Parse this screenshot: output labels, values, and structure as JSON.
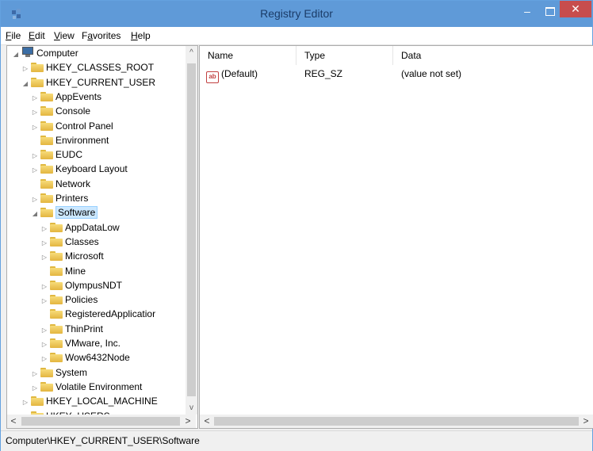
{
  "window": {
    "title": "Registry Editor",
    "minimize_glyph": "–",
    "close_glyph": "✕"
  },
  "menu": {
    "file": {
      "acc": "F",
      "rest": "ile"
    },
    "edit": {
      "acc": "E",
      "rest": "dit"
    },
    "view": {
      "acc": "V",
      "rest": "iew"
    },
    "favorites": {
      "pre": "F",
      "acc": "a",
      "rest": "vorites"
    },
    "help": {
      "acc": "H",
      "rest": "elp"
    }
  },
  "tree": {
    "nodes": [
      {
        "label": "Computer",
        "expander": "◢",
        "icon": "computer-icon"
      },
      {
        "label": "HKEY_CLASSES_ROOT",
        "expander": "▷",
        "icon": "folder-icon"
      },
      {
        "label": "HKEY_CURRENT_USER",
        "expander": "◢",
        "icon": "folder-icon"
      },
      {
        "label": "AppEvents",
        "expander": "▷",
        "icon": "folder-icon"
      },
      {
        "label": "Console",
        "expander": "▷",
        "icon": "folder-icon"
      },
      {
        "label": "Control Panel",
        "expander": "▷",
        "icon": "folder-icon"
      },
      {
        "label": "Environment",
        "expander": "",
        "icon": "folder-icon"
      },
      {
        "label": "EUDC",
        "expander": "▷",
        "icon": "folder-icon"
      },
      {
        "label": "Keyboard Layout",
        "expander": "▷",
        "icon": "folder-icon"
      },
      {
        "label": "Network",
        "expander": "",
        "icon": "folder-icon"
      },
      {
        "label": "Printers",
        "expander": "▷",
        "icon": "folder-icon"
      },
      {
        "label": "Software",
        "expander": "◢",
        "icon": "folder-icon",
        "selected": true
      },
      {
        "label": "AppDataLow",
        "expander": "▷",
        "icon": "folder-icon"
      },
      {
        "label": "Classes",
        "expander": "▷",
        "icon": "folder-icon"
      },
      {
        "label": "Microsoft",
        "expander": "▷",
        "icon": "folder-icon"
      },
      {
        "label": "Mine",
        "expander": "",
        "icon": "folder-icon"
      },
      {
        "label": "OlympusNDT",
        "expander": "▷",
        "icon": "folder-icon"
      },
      {
        "label": "Policies",
        "expander": "▷",
        "icon": "folder-icon"
      },
      {
        "label": "RegisteredApplicatior",
        "expander": "",
        "icon": "folder-icon"
      },
      {
        "label": "ThinPrint",
        "expander": "▷",
        "icon": "folder-icon"
      },
      {
        "label": "VMware, Inc.",
        "expander": "▷",
        "icon": "folder-icon"
      },
      {
        "label": "Wow6432Node",
        "expander": "▷",
        "icon": "folder-icon"
      },
      {
        "label": "System",
        "expander": "▷",
        "icon": "folder-icon"
      },
      {
        "label": "Volatile Environment",
        "expander": "▷",
        "icon": "folder-icon"
      },
      {
        "label": "HKEY_LOCAL_MACHINE",
        "expander": "▷",
        "icon": "folder-icon"
      },
      {
        "label": "HKEY_USERS",
        "expander": "▷",
        "icon": "folder-icon"
      }
    ],
    "scroll_up_glyph": "^",
    "scroll_down_glyph": "v",
    "scroll_left_glyph": "<",
    "scroll_right_glyph": ">"
  },
  "list": {
    "columns": {
      "name": "Name",
      "type": "Type",
      "data": "Data"
    },
    "rows": [
      {
        "icon": "ab",
        "name": "(Default)",
        "type": "REG_SZ",
        "data": "(value not set)"
      }
    ],
    "scroll_left_glyph": "<",
    "scroll_right_glyph": ">"
  },
  "status": {
    "path": "Computer\\HKEY_CURRENT_USER\\Software"
  },
  "colors": {
    "titlebar": "#5f9ad8",
    "close_button": "#c74d4d",
    "selection": "#cce8ff"
  }
}
